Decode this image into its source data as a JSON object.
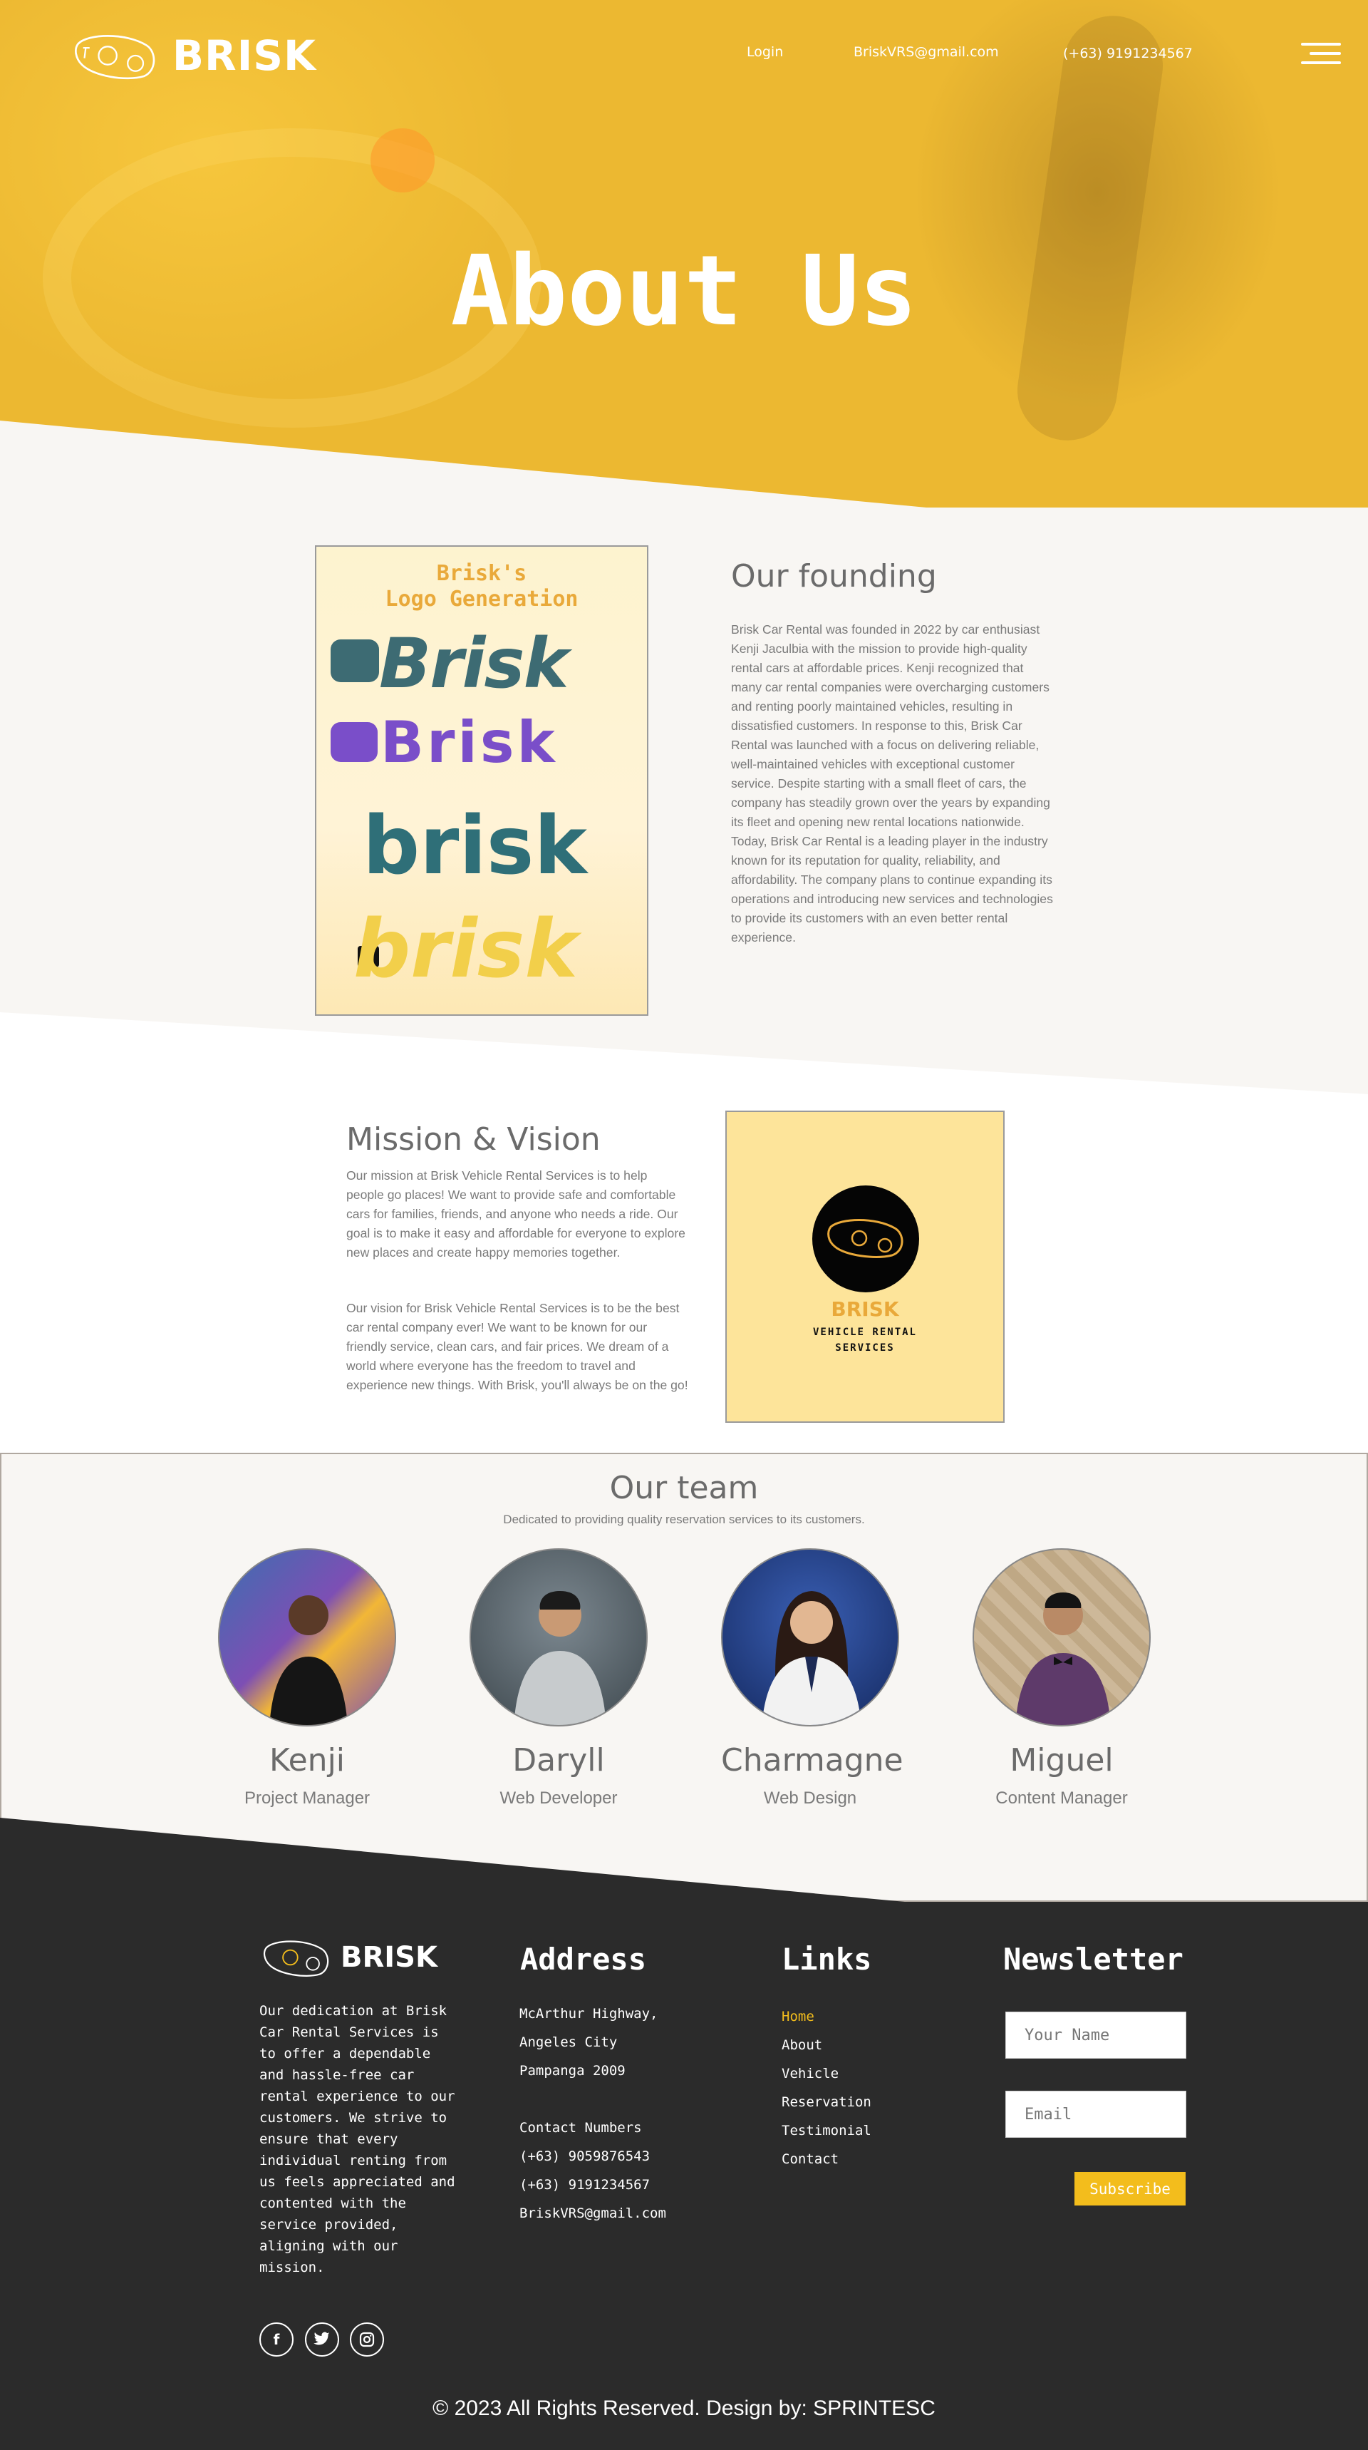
{
  "colors": {
    "accent": "#ecb831",
    "footer": "#2b2b2b",
    "link_active": "#f3bd1c"
  },
  "header": {
    "brand": "BRISK",
    "nav": {
      "login": "Login",
      "email": "BriskVRS@gmail.com",
      "phone": "(+63) 9191234567"
    },
    "menu_icon": "hamburger-icon"
  },
  "hero": {
    "title": "About Us"
  },
  "founding": {
    "card_title_line1": "Brisk's",
    "card_title_line2": "Logo Generation",
    "logo_variants": [
      "Brisk",
      "Brisk",
      "brisk",
      "brisk"
    ],
    "title": "Our founding",
    "text": "Brisk Car Rental was founded in 2022 by car enthusiast Kenji Jaculbia with the mission to provide high-quality rental cars at affordable prices. Kenji recognized that many car rental companies were overcharging customers and renting poorly maintained vehicles, resulting in dissatisfied customers. In response to this, Brisk Car Rental was launched with a focus on delivering reliable, well-maintained vehicles with exceptional customer service. Despite starting with a small fleet of cars, the company has steadily grown over the years by expanding its fleet and opening new rental locations nationwide. Today, Brisk Car Rental is a leading player in the industry known for its reputation for quality, reliability, and affordability. The company plans to continue expanding its operations and introducing new services and technologies to provide its customers with an even better rental experience."
  },
  "mission": {
    "title": "Mission & Vision",
    "mission_text": "Our mission at Brisk Vehicle Rental Services is to help people go places! We want to provide safe and comfortable cars for families, friends, and anyone who needs a ride. Our goal is to make it easy and affordable for everyone to explore new places and create happy memories together.",
    "vision_text": "Our vision for Brisk Vehicle Rental Services is to be the best car rental company ever! We want to be known for our friendly service, clean cars, and fair prices. We dream of a world where everyone has the freedom to travel and experience new things. With Brisk, you'll always be on the go!",
    "card_brand": "BRISK",
    "card_sub_line1": "VEHICLE RENTAL",
    "card_sub_line2": "SERVICES"
  },
  "team": {
    "title": "Our team",
    "subtitle": "Dedicated to providing quality reservation services to its customers.",
    "members": [
      {
        "name": "Kenji",
        "role": "Project Manager"
      },
      {
        "name": "Daryll",
        "role": "Web Developer"
      },
      {
        "name": "Charmagne",
        "role": "Web Design"
      },
      {
        "name": "Miguel",
        "role": "Content Manager"
      }
    ]
  },
  "footer": {
    "brand": "BRISK",
    "about": "Our dedication at Brisk Car Rental Services is to offer a dependable and hassle-free car rental experience to our customers. We strive to ensure that every individual renting from us feels appreciated and contented with the service provided, aligning with our mission.",
    "address_title": "Address",
    "address_lines": [
      "McArthur Highway,",
      "Angeles City",
      "Pampanga 2009"
    ],
    "contact_title": "Contact Numbers",
    "contact_lines": [
      "(+63) 9059876543",
      "(+63) 9191234567",
      "BriskVRS@gmail.com"
    ],
    "links_title": "Links",
    "links": [
      "Home",
      "About",
      "Vehicle",
      "Reservation",
      "Testimonial",
      "Contact"
    ],
    "newsletter_title": "Newsletter",
    "name_placeholder": "Your Name",
    "email_placeholder": "Email",
    "subscribe_label": "Subscribe",
    "social_icons": [
      "facebook-icon",
      "twitter-icon",
      "instagram-icon"
    ],
    "copyright": "© 2023 All Rights Reserved. Design by: SPRINTESC"
  }
}
